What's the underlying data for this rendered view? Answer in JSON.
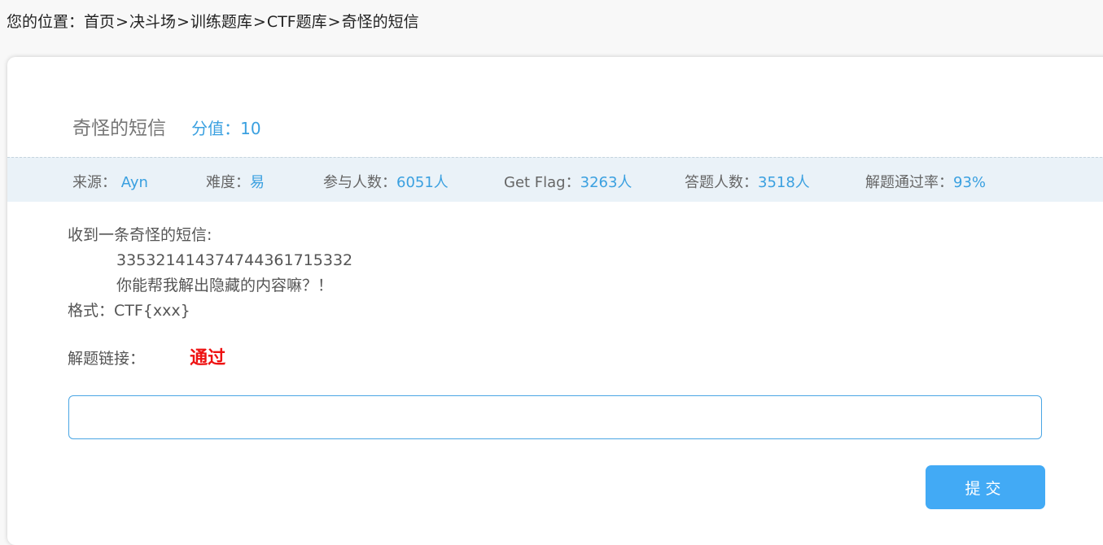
{
  "breadcrumb": {
    "prefix": "您的位置：",
    "items": [
      "首页",
      "决斗场",
      "训练题库",
      "CTF题库",
      "奇怪的短信"
    ],
    "separator": ">"
  },
  "challenge": {
    "title": "奇怪的短信",
    "score_label": "分值：",
    "score_value": "10"
  },
  "meta": {
    "source_label": "来源：",
    "source_value": "Ayn",
    "difficulty_label": "难度：",
    "difficulty_value": "易",
    "participants_label": "参与人数：",
    "participants_value": "6051人",
    "getflag_label": "Get Flag：",
    "getflag_value": "3263人",
    "answerers_label": "答题人数：",
    "answerers_value": "3518人",
    "passrate_label": "解题通过率：",
    "passrate_value": "93%"
  },
  "description": {
    "line1": "收到一条奇怪的短信:",
    "line2": "335321414374744361715332",
    "line3": "你能帮我解出隐藏的内容嘛？！",
    "line4": "格式：CTF{xxx}"
  },
  "link": {
    "label": "解题链接：",
    "value": "通过"
  },
  "form": {
    "flag_value": "",
    "flag_placeholder": "",
    "submit_label": "提交"
  },
  "colors": {
    "accent": "#3aa0e0",
    "button": "#42aaf5",
    "link_status": "#ee1111",
    "meta_bg": "#eaf2f8"
  }
}
